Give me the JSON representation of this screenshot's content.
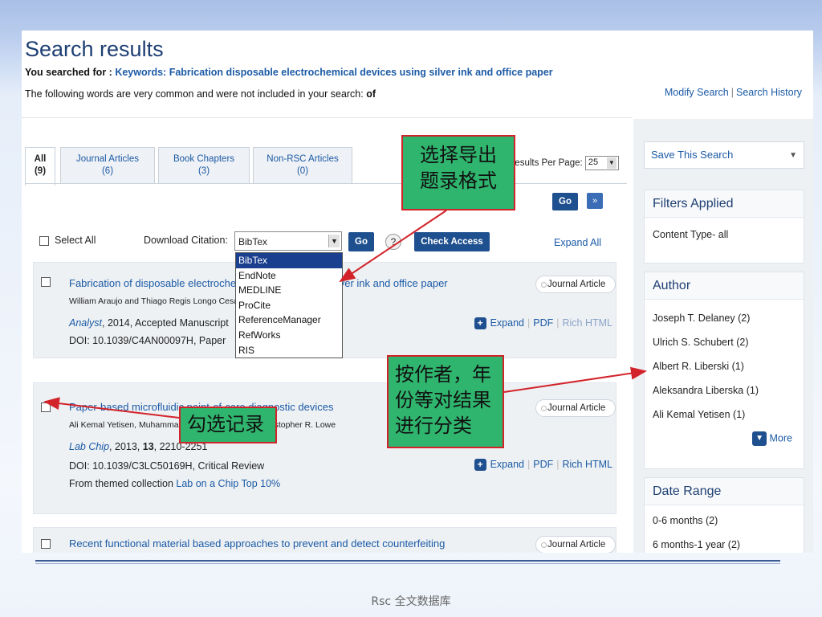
{
  "header": {
    "title": "Search results",
    "searched_label": "You searched for :",
    "searched_value": "Keywords: Fabrication disposable electrochemical devices using silver ink and office paper",
    "omitted_text": "The following words are very common and were not included in your search:",
    "omitted_word": "of",
    "modify_search": "Modify Search",
    "separator": "|",
    "search_history": "Search History"
  },
  "tabs": [
    {
      "label": "All",
      "count": "(9)"
    },
    {
      "label": "Journal Articles",
      "count": "(6)"
    },
    {
      "label": "Book Chapters",
      "count": "(3)"
    },
    {
      "label": "Non-RSC Articles",
      "count": "(0)"
    }
  ],
  "results_per_page": {
    "label": "Results Per Page:",
    "value": "25"
  },
  "pager": {
    "go": "Go",
    "next": "»"
  },
  "toolbar": {
    "select_all": "Select All",
    "download_citation": "Download Citation:",
    "citation_selected": "BibTex",
    "citation_options": [
      "BibTex",
      "EndNote",
      "MEDLINE",
      "ProCite",
      "ReferenceManager",
      "RefWorks",
      "RIS"
    ],
    "go": "Go",
    "help": "?",
    "check_access": "Check Access",
    "expand_all": "Expand All"
  },
  "results": [
    {
      "title": "Fabrication of disposable electrochemical devices using silver ink and office paper",
      "authors": "William Araujo and Thiago Regis Longo Cesar da Paixao",
      "journal": "Analyst",
      "journal_rest": ", 2014, Accepted Manuscript",
      "doi": "DOI: 10.1039/C4AN00097H, Paper",
      "type": "Journal Article",
      "expand": "Expand",
      "pdf": "PDF",
      "rich_html": "Rich HTML"
    },
    {
      "title": "Paper-based microfluidic point-of-care diagnostic devices",
      "authors": "Ali Kemal Yetisen, Muhammad Safwan Akram and Christopher R. Lowe",
      "journal": "Lab Chip",
      "journal_rest": ", 2013, ",
      "volume": "13",
      "pages": ", 2210-2251",
      "doi": "DOI: 10.1039/C3LC50169H, Critical Review",
      "collection_prefix": "From themed collection",
      "collection": "Lab on a Chip Top 10%",
      "type": "Journal Article",
      "expand": "Expand",
      "pdf": "PDF",
      "rich_html": "Rich HTML"
    },
    {
      "title": "Recent functional material based approaches to prevent and detect counterfeiting",
      "type": "Journal Article"
    }
  ],
  "sidebar": {
    "save_search": "Save This Search",
    "filters_title": "Filters Applied",
    "filters_value": "Content Type- all",
    "author_title": "Author",
    "authors": [
      "Joseph T. Delaney (2)",
      "Ulrich S. Schubert (2)",
      "Albert R. Liberski (1)",
      "Aleksandra Liberska (1)",
      "Ali Kemal Yetisen (1)"
    ],
    "more": "More",
    "date_title": "Date Range",
    "dates": [
      "0-6 months (2)",
      "6 months-1 year (2)"
    ]
  },
  "annotations": {
    "citation_format": "选择导出题录格式",
    "citation_format_l1": "选择导出",
    "citation_format_l2": "题录格式",
    "sort_l1": "按作者，年",
    "sort_l2": "份等对结果",
    "sort_l3": "进行分类",
    "check_record": "勾选记录"
  },
  "colors": {
    "annotation_bg": "#2fb56e",
    "annotation_border": "#d2232a",
    "arrow": "#d2232a",
    "link": "#1b5aa5",
    "button": "#1e4f8e"
  },
  "footer": "Rsc 全文数据库"
}
